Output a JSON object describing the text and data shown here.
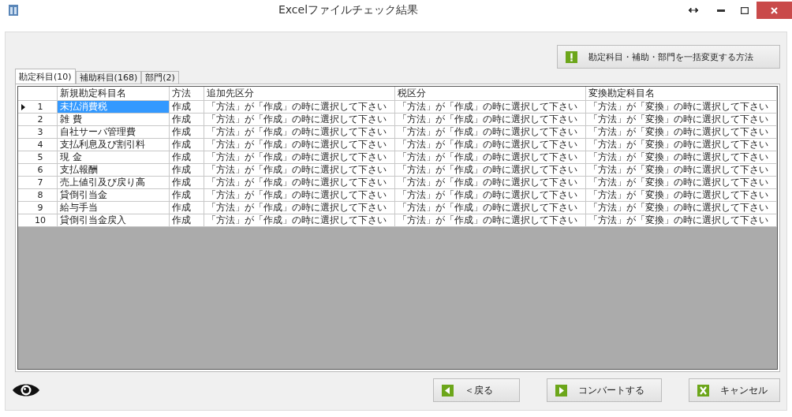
{
  "window": {
    "title": "Excelファイルチェック結果"
  },
  "bulk_button": {
    "label": "勘定科目・補助・部門を一括変更する方法"
  },
  "tabs": [
    {
      "label": "勘定科目(10)",
      "selected": true
    },
    {
      "label": "補助科目(168)",
      "selected": false
    },
    {
      "label": "部門(2)",
      "selected": false
    }
  ],
  "table": {
    "columns": [
      "新規勘定科目名",
      "方法",
      "追加先区分",
      "税区分",
      "変換勘定科目名"
    ],
    "rows": [
      {
        "number": "1",
        "cells": [
          "未払消費税",
          "作成",
          "「方法」が「作成」の時に選択して下さい",
          "「方法」が「作成」の時に選択して下さい",
          "「方法」が「変換」の時に選択して下さい"
        ],
        "selected": true
      },
      {
        "number": "2",
        "cells": [
          "雑 費",
          "作成",
          "「方法」が「作成」の時に選択して下さい",
          "「方法」が「作成」の時に選択して下さい",
          "「方法」が「変換」の時に選択して下さい"
        ],
        "selected": false
      },
      {
        "number": "3",
        "cells": [
          "自社サーバ管理費",
          "作成",
          "「方法」が「作成」の時に選択して下さい",
          "「方法」が「作成」の時に選択して下さい",
          "「方法」が「変換」の時に選択して下さい"
        ],
        "selected": false
      },
      {
        "number": "4",
        "cells": [
          "支払利息及び割引料",
          "作成",
          "「方法」が「作成」の時に選択して下さい",
          "「方法」が「作成」の時に選択して下さい",
          "「方法」が「変換」の時に選択して下さい"
        ],
        "selected": false
      },
      {
        "number": "5",
        "cells": [
          "現 金",
          "作成",
          "「方法」が「作成」の時に選択して下さい",
          "「方法」が「作成」の時に選択して下さい",
          "「方法」が「変換」の時に選択して下さい"
        ],
        "selected": false
      },
      {
        "number": "6",
        "cells": [
          "支払報酬",
          "作成",
          "「方法」が「作成」の時に選択して下さい",
          "「方法」が「作成」の時に選択して下さい",
          "「方法」が「変換」の時に選択して下さい"
        ],
        "selected": false
      },
      {
        "number": "7",
        "cells": [
          "売上値引及び戻り高",
          "作成",
          "「方法」が「作成」の時に選択して下さい",
          "「方法」が「作成」の時に選択して下さい",
          "「方法」が「変換」の時に選択して下さい"
        ],
        "selected": false
      },
      {
        "number": "8",
        "cells": [
          "貸倒引当金",
          "作成",
          "「方法」が「作成」の時に選択して下さい",
          "「方法」が「作成」の時に選択して下さい",
          "「方法」が「変換」の時に選択して下さい"
        ],
        "selected": false
      },
      {
        "number": "9",
        "cells": [
          "給与手当",
          "作成",
          "「方法」が「作成」の時に選択して下さい",
          "「方法」が「作成」の時に選択して下さい",
          "「方法」が「変換」の時に選択して下さい"
        ],
        "selected": false
      },
      {
        "number": "10",
        "cells": [
          "貸倒引当金戻入",
          "作成",
          "「方法」が「作成」の時に選択して下さい",
          "「方法」が「作成」の時に選択して下さい",
          "「方法」が「変換」の時に選択して下さい"
        ],
        "selected": false
      }
    ]
  },
  "footer_buttons": [
    {
      "label": "＜戻る",
      "kind": "back"
    },
    {
      "label": "コンバートする",
      "kind": "convert"
    },
    {
      "label": "キャンセル",
      "kind": "cancel"
    }
  ]
}
